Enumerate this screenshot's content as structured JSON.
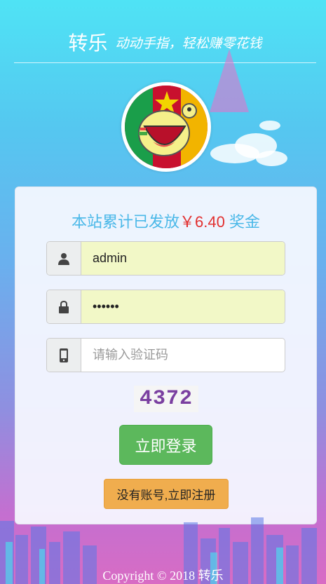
{
  "header": {
    "brand": "转乐",
    "tagline": "动动手指，轻松赚零花钱"
  },
  "stats": {
    "prefix": "本站累计已发放",
    "amount": "￥6.40",
    "suffix": "奖金"
  },
  "form": {
    "username": {
      "value": "admin",
      "icon": "user-icon"
    },
    "password": {
      "value": "••••••",
      "icon": "lock-icon"
    },
    "captcha": {
      "placeholder": "请输入验证码",
      "icon": "phone-icon"
    },
    "captcha_code": "4372"
  },
  "buttons": {
    "login": "立即登录",
    "register": "没有账号,立即注册"
  },
  "footer": {
    "copyright": "Copyright © 2018 转乐"
  },
  "colors": {
    "login": "#5cb85c",
    "register": "#f0ad4e",
    "amount": "#e23030",
    "stat_text": "#4ab8e8"
  }
}
